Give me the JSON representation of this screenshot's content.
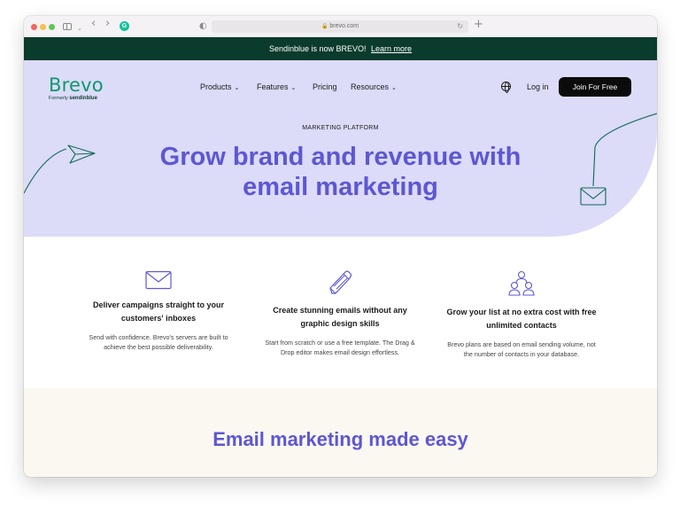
{
  "browser": {
    "url": "brevo.com",
    "grammarly_label": "G",
    "back_glyph": "‹",
    "forward_glyph": "›",
    "reload_glyph": "↻",
    "newtab_glyph": "+",
    "shield_glyph": "◐",
    "lock_glyph": "🔒"
  },
  "announcement": {
    "text": "Sendinblue is now BREVO!",
    "link": "Learn more"
  },
  "header": {
    "logo": "Brevo",
    "logo_sub_prefix": "Formerly",
    "logo_sub_brand": "sendinblue",
    "nav": [
      {
        "label": "Products",
        "chevron": "⌄"
      },
      {
        "label": "Features",
        "chevron": "⌄"
      },
      {
        "label": "Pricing",
        "chevron": ""
      },
      {
        "label": "Resources",
        "chevron": "⌄"
      }
    ],
    "login": "Log in",
    "cta": "Join For Free"
  },
  "hero": {
    "eyebrow": "MARKETING PLATFORM",
    "headline_line1": "Grow brand and revenue with",
    "headline_line2": "email marketing"
  },
  "features": [
    {
      "icon": "envelope-icon",
      "title_line1": "Deliver campaigns straight to your",
      "title_line2": "customers' inboxes",
      "desc_line1": "Send with confidence. Brevo's servers are built to",
      "desc_line2": "achieve the best possible deliverability."
    },
    {
      "icon": "pencil-icon",
      "title_line1": "Create stunning emails without any",
      "title_line2": "graphic design skills",
      "desc_line1": "Start from scratch or use a free template. The Drag &",
      "desc_line2": "Drop editor makes email design effortless."
    },
    {
      "icon": "contacts-icon",
      "title_line1": "Grow your list at no extra cost with free",
      "title_line2": "unlimited contacts",
      "desc_line1": "Brevo plans are based on email sending volume, not",
      "desc_line2": "the number of contacts in your database."
    }
  ],
  "section": {
    "title": "Email marketing made easy"
  },
  "colors": {
    "brand_green": "#0b996e",
    "dark_green": "#0b3b2c",
    "hero_bg": "#dcdbf8",
    "accent_purple": "#5d57d3",
    "cream": "#fbf8f1"
  }
}
